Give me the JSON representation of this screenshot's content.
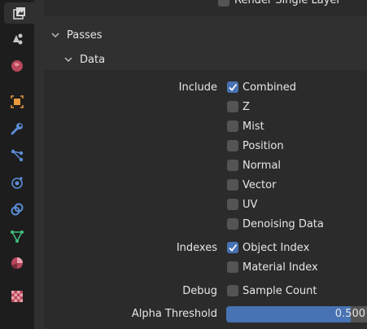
{
  "top": {
    "render_single_layer": "Render Single Layer"
  },
  "sections": {
    "passes": "Passes",
    "data": "Data"
  },
  "include": {
    "label": "Include",
    "items": [
      {
        "label": "Combined",
        "checked": true
      },
      {
        "label": "Z",
        "checked": false
      },
      {
        "label": "Mist",
        "checked": false
      },
      {
        "label": "Position",
        "checked": false
      },
      {
        "label": "Normal",
        "checked": false
      },
      {
        "label": "Vector",
        "checked": false
      },
      {
        "label": "UV",
        "checked": false
      },
      {
        "label": "Denoising Data",
        "checked": false
      }
    ]
  },
  "indexes": {
    "label": "Indexes",
    "items": [
      {
        "label": "Object Index",
        "checked": true
      },
      {
        "label": "Material Index",
        "checked": false
      }
    ]
  },
  "debug": {
    "label": "Debug",
    "items": [
      {
        "label": "Sample Count",
        "checked": false
      }
    ]
  },
  "alpha": {
    "label": "Alpha Threshold",
    "value": "0.500",
    "fraction": 0.5
  },
  "colors": {
    "accent": "#4772b3",
    "panel": "#303030",
    "sidebar": "#1d1d1d"
  },
  "tab_icons": [
    "render-icon",
    "output-icon",
    "view-layer-icon",
    "scene-icon",
    "world-icon",
    "object-icon",
    "modifier-icon",
    "particles-icon",
    "physics-icon",
    "constraints-icon",
    "object-data-icon",
    "material-icon",
    "texture-icon"
  ]
}
